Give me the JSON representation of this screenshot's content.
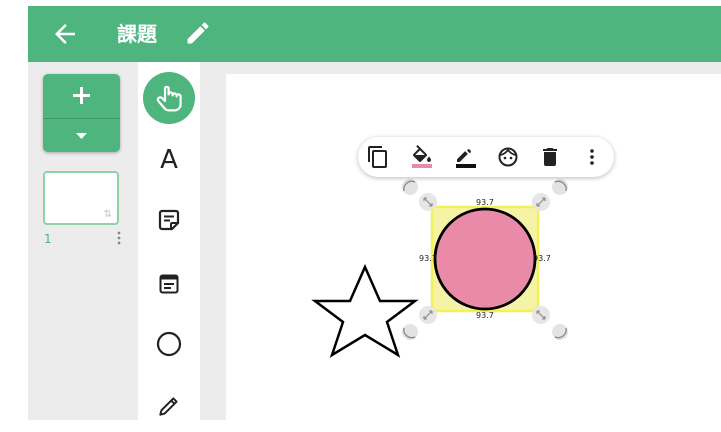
{
  "header": {
    "title": "課題",
    "back_icon": "arrow-left-icon",
    "edit_icon": "pencil-icon",
    "color": "#4db57d"
  },
  "pages_panel": {
    "add_icon": "plus-icon",
    "dropdown_icon": "caret-down-icon",
    "pages": [
      {
        "number": "1",
        "menu_icon": "more-vertical-icon"
      }
    ]
  },
  "tools": [
    {
      "name": "select",
      "icon": "hand-pointer-icon",
      "selected": true
    },
    {
      "name": "text",
      "label": "A",
      "icon": "text-icon"
    },
    {
      "name": "sticky-note",
      "icon": "sticky-note-icon"
    },
    {
      "name": "card",
      "icon": "card-icon"
    },
    {
      "name": "shape",
      "icon": "circle-icon"
    },
    {
      "name": "pen",
      "icon": "pencil-icon"
    }
  ],
  "context_menu": [
    {
      "name": "duplicate",
      "icon": "copy-icon"
    },
    {
      "name": "fill",
      "icon": "fill-bucket-icon",
      "color": "#e98aa9"
    },
    {
      "name": "stroke",
      "icon": "line-color-icon",
      "color": "#111111"
    },
    {
      "name": "sticker",
      "icon": "face-icon"
    },
    {
      "name": "delete",
      "icon": "trash-icon"
    },
    {
      "name": "more",
      "icon": "more-vertical-icon"
    }
  ],
  "selection": {
    "width_label_top": "93.7",
    "width_label_bottom": "93.7",
    "height_label_left": "93.7",
    "height_label_right": "93.7",
    "shape": "circle",
    "fill": "#e98aa9",
    "highlight": "#f4f05a"
  },
  "canvas_objects": [
    {
      "type": "star",
      "stroke": "#000000",
      "fill": "#ffffff"
    }
  ]
}
